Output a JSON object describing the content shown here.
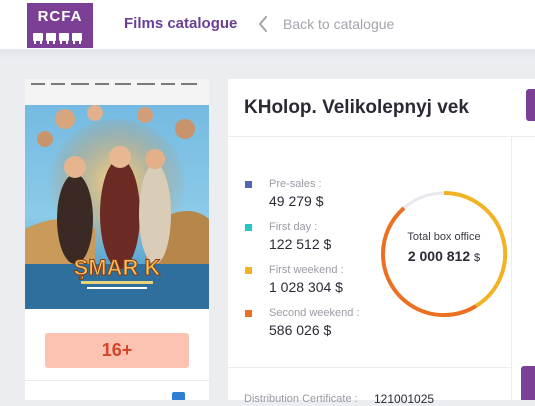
{
  "header": {
    "logo_text": "RCFA",
    "nav_title": "Films catalogue",
    "back_label": "Back to catalogue"
  },
  "poster": {
    "title_text": "ŞMAR K",
    "age_rating": "16+"
  },
  "film": {
    "title": "KHolop. Velikolepnyj vek"
  },
  "box_office": {
    "currency": "$",
    "stats": [
      {
        "label": "Pre-sales :",
        "value": "49 279 $",
        "color": "#4f67b1"
      },
      {
        "label": "First day :",
        "value": "122 512 $",
        "color": "#22c6c8"
      },
      {
        "label": "First weekend :",
        "value": "1 028 304 $",
        "color": "#f1b323"
      },
      {
        "label": "Second weekend :",
        "value": "586 026 $",
        "color": "#ec7022"
      }
    ],
    "total_label": "Total box office",
    "total_value": "2 000 812",
    "ring_colors": {
      "track": "#e8e8ec",
      "weekend": "#f1b323",
      "second": "#ec7022"
    }
  },
  "certificate": {
    "label": "Distribution Certificate :",
    "value": "121001025"
  },
  "colors": {
    "brand": "#7b3f95",
    "nav_text": "#6b3f95",
    "badge_bg": "#fcc3b3",
    "badge_text": "#d64527",
    "page_bg": "#ecedf1"
  }
}
